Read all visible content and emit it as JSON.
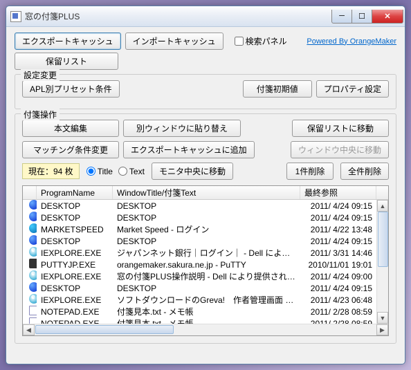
{
  "title": "窓の付箋PLUS",
  "toolbar": {
    "export_cache": "エクスポートキャッシュ",
    "import_cache": "インポートキャッシュ",
    "search_panel": "検索パネル",
    "powered_by": "Powered By OrangeMaker",
    "hold_list": "保留リスト"
  },
  "settings_group": {
    "label": "設定変更",
    "apl_preset": "APL別プリセット条件",
    "sticky_default": "付箋初期値",
    "property": "プロパティ設定"
  },
  "operation_group": {
    "label": "付箋操作",
    "edit_body": "本文編集",
    "paste_other": "別ウィンドウに貼り替え",
    "move_hold": "保留リストに移動",
    "change_match": "マッチング条件変更",
    "add_export": "エクスポートキャッシュに追加",
    "move_center": "ウィンドウ中央に移動",
    "status": "現在：94 枚",
    "radio_title": "Title",
    "radio_text": "Text",
    "monitor_center": "モニタ中央に移動",
    "delete_one": "1件削除",
    "delete_all": "全件削除"
  },
  "list": {
    "headers": {
      "program": "ProgramName",
      "title": "WindowTitle/付箋Text",
      "date": "最終参照"
    },
    "rows": [
      {
        "icon": "blue",
        "prog": "DESKTOP",
        "title": "DESKTOP",
        "date": "2011/ 4/24 09:15"
      },
      {
        "icon": "blue",
        "prog": "DESKTOP",
        "title": "DESKTOP",
        "date": "2011/ 4/24 09:15"
      },
      {
        "icon": "mkt",
        "prog": "MARKETSPEED",
        "title": "Market Speed - ログイン",
        "date": "2011/ 4/22 13:48"
      },
      {
        "icon": "blue",
        "prog": "DESKTOP",
        "title": "DESKTOP",
        "date": "2011/ 4/24 09:15"
      },
      {
        "icon": "ie",
        "prog": "IEXPLORE.EXE",
        "title": "ジャパンネット銀行｜ログイン｜ - Dell により提供され…",
        "date": "2011/ 3/31 14:46"
      },
      {
        "icon": "putty",
        "prog": "PUTTYJP.EXE",
        "title": "orangemaker.sakura.ne.jp - PuTTY",
        "date": "2010/11/01 19:01"
      },
      {
        "icon": "ie",
        "prog": "IEXPLORE.EXE",
        "title": "窓の付箋PLUS操作説明 - Dell により提供された Intern…",
        "date": "2011/ 4/24 09:00"
      },
      {
        "icon": "blue",
        "prog": "DESKTOP",
        "title": "DESKTOP",
        "date": "2011/ 4/24 09:15"
      },
      {
        "icon": "ie",
        "prog": "IEXPLORE.EXE",
        "title": "ソフトダウンロードのGreva!　作者管理画面 - Dell によ…",
        "date": "2011/ 4/23 06:48"
      },
      {
        "icon": "note",
        "prog": "NOTEPAD.EXE",
        "title": "付箋見本.txt - メモ帳",
        "date": "2011/ 2/28 08:59"
      },
      {
        "icon": "note",
        "prog": "NOTEPAD.EXE",
        "title": "付箋見本.txt - メモ帳",
        "date": "2011/ 2/28 08:59"
      }
    ]
  }
}
